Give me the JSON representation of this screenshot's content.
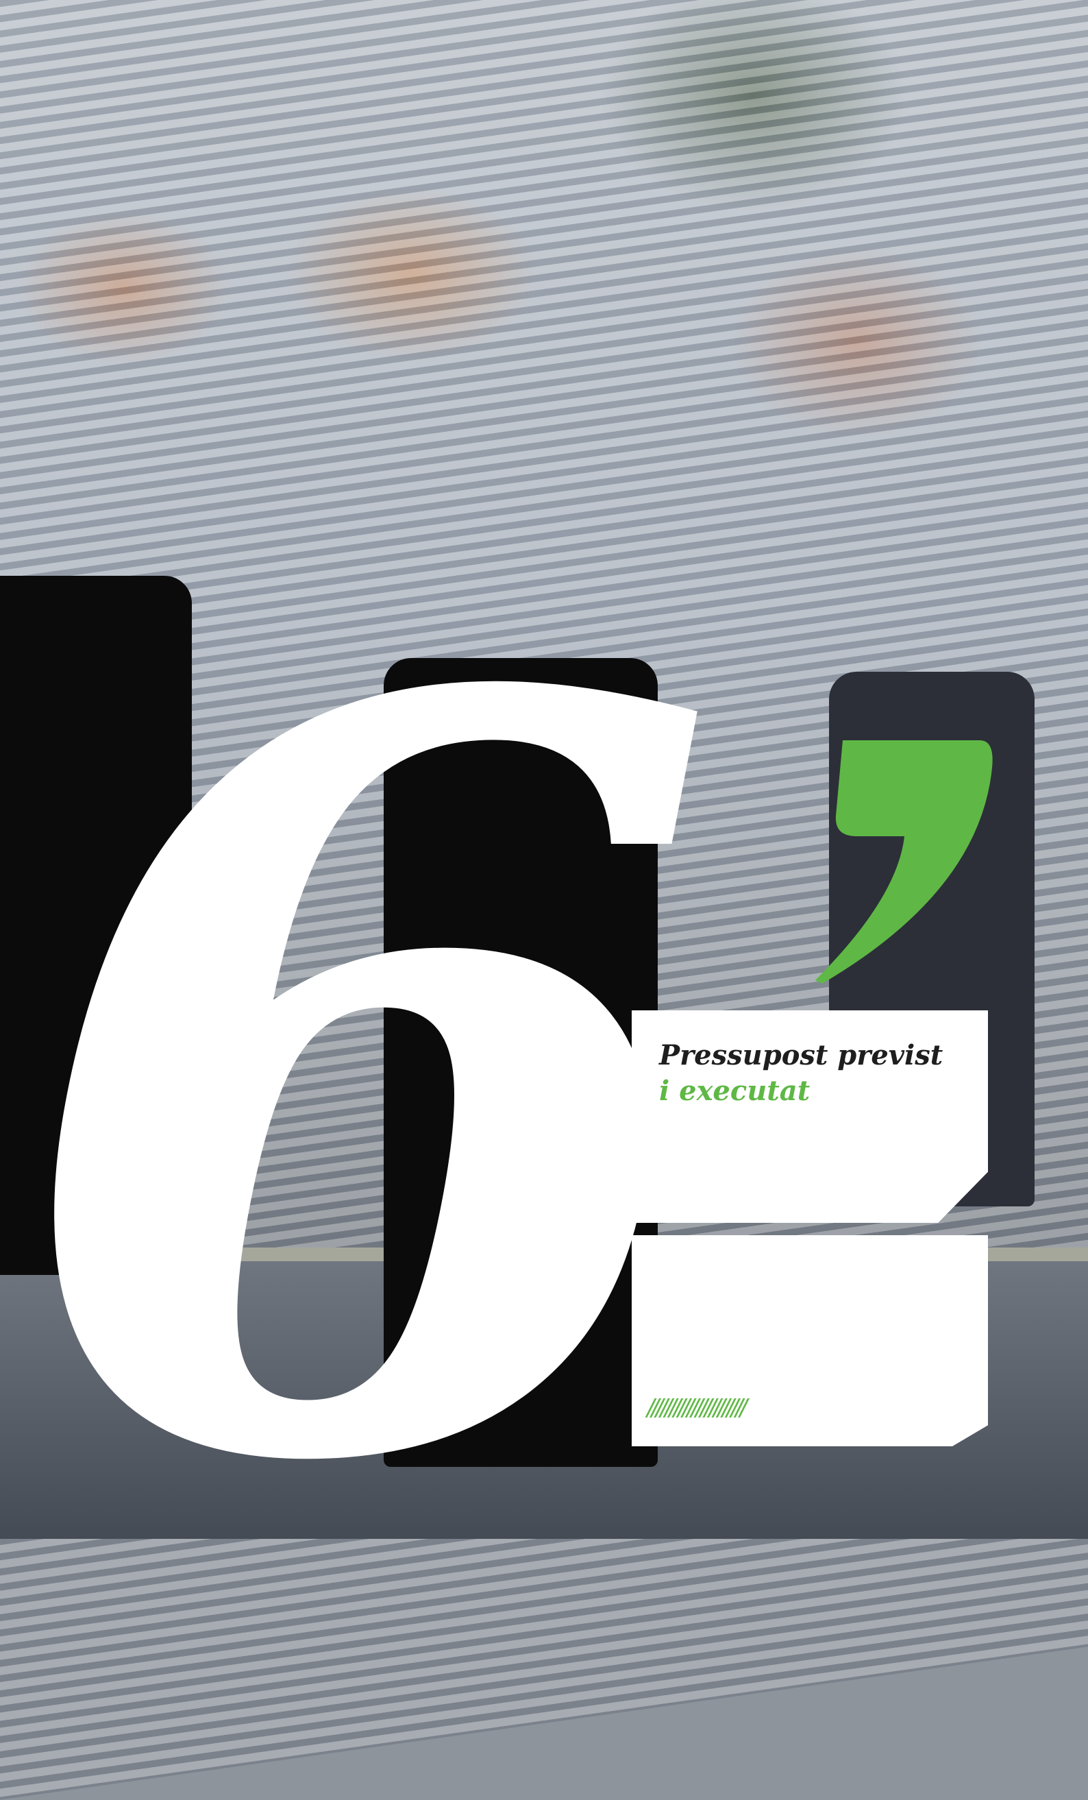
{
  "chapter": {
    "number": "6",
    "title_line1": "Pressupost previst",
    "title_line2": "i executat",
    "decoration": "//////////////////////"
  },
  "colors": {
    "accent_green": "#5fb845",
    "number_color": "#ffffff",
    "title_dark": "#1e1e1e"
  }
}
